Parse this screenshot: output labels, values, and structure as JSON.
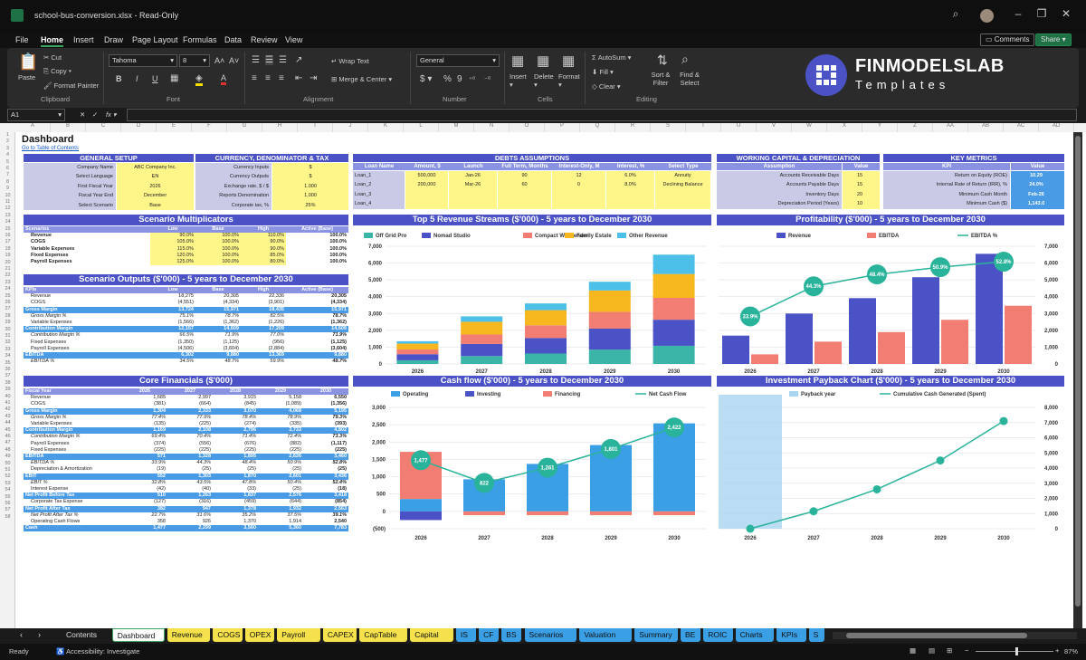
{
  "app": {
    "filename": "school-bus-conversion.xlsx",
    "mode": "Read-Only"
  },
  "menu": [
    "File",
    "Home",
    "Insert",
    "Draw",
    "Page Layout",
    "Formulas",
    "Data",
    "Review",
    "View"
  ],
  "top_buttons": {
    "comments": "Comments",
    "share": "Share"
  },
  "ribbon": {
    "paste": "Paste",
    "cut": "Cut",
    "copy": "Copy",
    "format_painter": "Format Painter",
    "clipboard": "Clipboard",
    "font_name": "Tahoma",
    "font_size": "8",
    "font": "Font",
    "wrap_text": "Wrap Text",
    "merge_center": "Merge & Center",
    "alignment": "Alignment",
    "number_format": "General",
    "number": "Number",
    "insert": "Insert",
    "delete": "Delete",
    "format": "Format",
    "cells": "Cells",
    "autosum": "AutoSum",
    "fill": "Fill",
    "clear": "Clear",
    "sort_filter": "Sort & Filter",
    "find_select": "Find & Select",
    "editing": "Editing",
    "bold": "B",
    "italic": "I",
    "underline": "U",
    "grow": "A",
    "fx": "fx"
  },
  "logo": {
    "line1": "FINMODELSLAB",
    "line2": "Templates"
  },
  "namebox": "A1",
  "columns": [
    "A",
    "B",
    "C",
    "D",
    "E",
    "F",
    "G",
    "H",
    "I",
    "J",
    "K",
    "L",
    "M",
    "N",
    "O",
    "P",
    "Q",
    "R",
    "S",
    "T",
    "U",
    "V",
    "W",
    "X",
    "Y",
    "Z",
    "AA",
    "AB",
    "AC",
    "AD"
  ],
  "sheet": {
    "title": "Dashboard",
    "toc_link": "Go to Table of Contents",
    "general_setup": {
      "title": "GENERAL SETUP",
      "rows": [
        [
          "Company Name",
          "ABC Company Inc."
        ],
        [
          "Select Language",
          "EN"
        ],
        [
          "First Fiscal Year",
          "2026"
        ],
        [
          "Fiscal Year End",
          "December"
        ],
        [
          "Select Scenario",
          "Base"
        ]
      ]
    },
    "currency": {
      "title": "CURRENCY, DENOMINATOR & TAX",
      "rows": [
        [
          "Currency Inputs",
          "$"
        ],
        [
          "Currency Outputs",
          "$"
        ],
        [
          "Exchange rate, $ / $",
          "1.000"
        ],
        [
          "Reports Denomination",
          "1,000"
        ],
        [
          "Corporate tax, %",
          "25%"
        ]
      ]
    },
    "debts": {
      "title": "DEBTS ASSUMPTIONS",
      "headers": [
        "Loan Name",
        "Amount, $",
        "Launch",
        "Full Term, Months",
        "Interest-Only, M",
        "Interest, %",
        "Select Type"
      ],
      "rows": [
        [
          "Loan_1",
          "500,000",
          "Jan-26",
          "90",
          "12",
          "6.0%",
          "Annuity"
        ],
        [
          "Loan_2",
          "200,000",
          "Mar-26",
          "60",
          "0",
          "8.0%",
          "Declining Balance"
        ],
        [
          "Loan_3",
          "",
          "",
          "",
          "",
          "",
          ""
        ],
        [
          "Loan_4",
          "",
          "",
          "",
          "",
          "",
          ""
        ]
      ]
    },
    "wc": {
      "title": "WORKING CAPITAL & DEPRECIATION",
      "headers": [
        "Assumption",
        "Value"
      ],
      "rows": [
        [
          "Accounts Receivable Days",
          "15"
        ],
        [
          "Accounts Payable Days",
          "15"
        ],
        [
          "Inventory Days",
          "20"
        ],
        [
          "Depreciation Period (Years)",
          "10"
        ]
      ]
    },
    "km": {
      "title": "KEY METRICS",
      "headers": [
        "KPI",
        "Value"
      ],
      "rows": [
        [
          "Return on Equity (ROE)",
          "10.29"
        ],
        [
          "Internal Rate of Return (IRR), %",
          "24.0%"
        ],
        [
          "Minimum Cash Month",
          "Feb-26"
        ],
        [
          "Minimum Cash ($)",
          "1,143.0"
        ]
      ]
    },
    "scen_mult": {
      "title": "Scenario Multiplicators",
      "headers": [
        "Scenarios",
        "Low",
        "Base",
        "High",
        "Active (Base)"
      ],
      "rows": [
        [
          "Revenue",
          "90.0%",
          "100.0%",
          "110.0%",
          "100.0%"
        ],
        [
          "COGS",
          "105.0%",
          "100.0%",
          "90.0%",
          "100.0%"
        ],
        [
          "Variable Expenses",
          "115.0%",
          "100.0%",
          "90.0%",
          "100.0%"
        ],
        [
          "Fixed Expenses",
          "120.0%",
          "100.0%",
          "85.0%",
          "100.0%"
        ],
        [
          "Payroll Expenses",
          "125.0%",
          "100.0%",
          "80.0%",
          "100.0%"
        ]
      ]
    },
    "scen_out": {
      "title": "Scenario Outputs ($'000) - 5 years to December 2030",
      "headers": [
        "KPIs",
        "Low",
        "Base",
        "High",
        "Active (Base)"
      ],
      "rows": [
        [
          "Revenue",
          "18,275",
          "20,305",
          "22,336",
          "20,305",
          ""
        ],
        [
          "COGS",
          "(4,551)",
          "(4,334)",
          "(3,901)",
          "(4,334)",
          ""
        ],
        [
          "Gross Margin",
          "13,724",
          "15,971",
          "18,435",
          "15,971",
          "hl"
        ],
        [
          "Gross Margin %",
          "75.1%",
          "78.7%",
          "82.5%",
          "78.7%",
          "it"
        ],
        [
          "Variable Expenses",
          "(1,566)",
          "(1,362)",
          "(1,226)",
          "(1,362)",
          ""
        ],
        [
          "Contribution Margin",
          "12,157",
          "14,609",
          "17,209",
          "14,609",
          "hl"
        ],
        [
          "Contribution Margin %",
          "66.5%",
          "71.9%",
          "77.0%",
          "71.9%",
          "it"
        ],
        [
          "Fixed Expenses",
          "(1,350)",
          "(1,125)",
          "(956)",
          "(1,125)",
          ""
        ],
        [
          "Payroll Expenses",
          "(4,506)",
          "(3,604)",
          "(2,884)",
          "(3,604)",
          ""
        ],
        [
          "EBITDA",
          "6,302",
          "9,880",
          "13,369",
          "9,880",
          "hl"
        ],
        [
          "EBITDA %",
          "34.5%",
          "48.7%",
          "59.9%",
          "48.7%",
          "it"
        ]
      ]
    },
    "core": {
      "title": "Core Financials ($'000)",
      "headers": [
        "Fiscal Year",
        "2026",
        "2027",
        "2028",
        "2029",
        "2030"
      ],
      "rows": [
        [
          "Revenue",
          "1,685",
          "2,997",
          "3,915",
          "5,158",
          "6,550",
          ""
        ],
        [
          "COGS",
          "(381)",
          "(664)",
          "(845)",
          "(1,089)",
          "(1,356)",
          ""
        ],
        [
          "Gross Margin",
          "1,304",
          "2,333",
          "3,070",
          "4,068",
          "5,195",
          "hl"
        ],
        [
          "Gross Margin %",
          "77.4%",
          "77.9%",
          "78.4%",
          "78.9%",
          "79.3%",
          "it"
        ],
        [
          "Variable Expenses",
          "(135)",
          "(225)",
          "(274)",
          "(335)",
          "(393)",
          ""
        ],
        [
          "Contribution Margin",
          "1,169",
          "2,108",
          "2,796",
          "3,733",
          "4,802",
          "hl"
        ],
        [
          "Contribution Margin %",
          "69.4%",
          "70.4%",
          "71.4%",
          "72.4%",
          "73.3%",
          "it"
        ],
        [
          "Payroll Expenses",
          "(374)",
          "(556)",
          "(676)",
          "(882)",
          "(1,117)",
          ""
        ],
        [
          "Fixed Expenses",
          "(225)",
          "(225)",
          "(225)",
          "(225)",
          "(225)",
          ""
        ],
        [
          "EBITDA",
          "571",
          "1,328",
          "1,895",
          "2,626",
          "3,460",
          "hl"
        ],
        [
          "EBITDA %",
          "33.9%",
          "44.3%",
          "48.4%",
          "50.9%",
          "52.8%",
          "it"
        ],
        [
          "Depreciation & Amortization",
          "(19)",
          "(25)",
          "(25)",
          "(25)",
          "(25)",
          ""
        ],
        [
          "EBIT",
          "552",
          "1,303",
          "1,870",
          "2,601",
          "3,436",
          "hl"
        ],
        [
          "EBIT %",
          "32.8%",
          "43.5%",
          "47.8%",
          "50.4%",
          "52.4%",
          "it"
        ],
        [
          "Interest Expense",
          "(42)",
          "(40)",
          "(33)",
          "(25)",
          "(18)",
          ""
        ],
        [
          "Net Profit Before Tax",
          "510",
          "1,263",
          "1,837",
          "2,576",
          "3,418",
          "hl"
        ],
        [
          "Corporate Tax Expense",
          "(127)",
          "(316)",
          "(459)",
          "(644)",
          "(854)",
          ""
        ],
        [
          "Net Profit After Tax",
          "382",
          "947",
          "1,378",
          "1,932",
          "2,563",
          "hl"
        ],
        [
          "Net Profit After Tax %",
          "22.7%",
          "31.6%",
          "35.2%",
          "37.5%",
          "39.1%",
          "it"
        ],
        [
          "Operating Cash Flows",
          "358",
          "926",
          "1,370",
          "1,914",
          "2,540",
          ""
        ],
        [
          "Cash",
          "1,477",
          "2,299",
          "3,560",
          "5,360",
          "7,783",
          "hl"
        ]
      ]
    }
  },
  "chart_data": [
    {
      "type": "bar",
      "title": "Top 5 Revenue Streams ($'000) - 5 years to December 2030",
      "stacked": true,
      "categories": [
        "2026",
        "2027",
        "2028",
        "2029",
        "2030"
      ],
      "series": [
        {
          "name": "Off Grid Pro",
          "values": [
            220,
            470,
            620,
            850,
            1080
          ]
        },
        {
          "name": "Nomad Studio",
          "values": [
            360,
            720,
            920,
            1250,
            1550
          ]
        },
        {
          "name": "Compact Weekender",
          "values": [
            280,
            560,
            760,
            1000,
            1300
          ]
        },
        {
          "name": "Family Estate",
          "values": [
            350,
            760,
            900,
            1270,
            1420
          ]
        },
        {
          "name": "Other Revenue",
          "values": [
            140,
            320,
            400,
            520,
            1150
          ]
        }
      ],
      "ylim": [
        0,
        7000
      ],
      "yticks": [
        "0",
        "1,000",
        "2,000",
        "3,000",
        "4,000",
        "5,000",
        "6,000",
        "7,000"
      ],
      "legend": "top",
      "colors": [
        "#3ab5a8",
        "#4a52c6",
        "#f27d72",
        "#f6b81e",
        "#4cc0e8"
      ]
    },
    {
      "type": "bar+line",
      "title": "Profitability ($'000) - 5 years to December 2030",
      "categories": [
        "2026",
        "2027",
        "2028",
        "2029",
        "2030"
      ],
      "series": [
        {
          "name": "Revenue",
          "values": [
            1685,
            2997,
            3915,
            5158,
            6550
          ]
        },
        {
          "name": "EBITDA",
          "values": [
            571,
            1328,
            1895,
            2626,
            3460
          ]
        },
        {
          "name": "EBITDA %",
          "values": [
            33.9,
            44.3,
            48.4,
            50.9,
            52.8
          ],
          "labels": [
            "33.9%",
            "44.3%",
            "48.4%",
            "50.9%",
            "52.8%"
          ]
        }
      ],
      "ylim": [
        0,
        7000
      ],
      "yticks": [
        "0",
        "1,000",
        "2,000",
        "3,000",
        "4,000",
        "5,000",
        "6,000",
        "7,000"
      ],
      "legend": "top",
      "colors": [
        "#4a52c6",
        "#f27d72",
        "#2ab39b"
      ]
    },
    {
      "type": "bar+line",
      "title": "Cash flow ($'000) - 5 years to December 2030",
      "categories": [
        "2026",
        "2027",
        "2028",
        "2029",
        "2030"
      ],
      "series": [
        {
          "name": "Operating",
          "values": [
            358,
            926,
            1370,
            1914,
            2540
          ]
        },
        {
          "name": "Investing",
          "values": [
            -250,
            0,
            0,
            0,
            0
          ]
        },
        {
          "name": "Financing",
          "values": [
            1360,
            -110,
            -110,
            -110,
            -110
          ]
        },
        {
          "name": "Net Cash Flow",
          "values": [
            1477,
            822,
            1261,
            1801,
            2422
          ],
          "labels": [
            "1,477",
            "822",
            "1,261",
            "1,801",
            "2,422"
          ]
        }
      ],
      "ylim": [
        -500,
        3000
      ],
      "yticks": [
        "(500)",
        "0",
        "500",
        "1,000",
        "1,500",
        "2,000",
        "2,500",
        "3,000"
      ],
      "legend": "top",
      "colors": [
        "#3a9fe5",
        "#4a52c6",
        "#f27d72",
        "#2ab39b"
      ]
    },
    {
      "type": "line",
      "title": "Investment Payback Chart ($'000) - 5 years to December 2030",
      "categories": [
        "2026",
        "2027",
        "2028",
        "2029",
        "2030"
      ],
      "series": [
        {
          "name": "Payback year",
          "values": [
            1,
            0,
            0,
            0,
            0
          ]
        },
        {
          "name": "Cumulative Cash Generated (Spent)",
          "values": [
            0,
            1150,
            2600,
            4500,
            7100
          ]
        }
      ],
      "ylim": [
        0,
        8000
      ],
      "yticks": [
        "0",
        "1,000",
        "2,000",
        "3,000",
        "4,000",
        "5,000",
        "6,000",
        "7,000",
        "8,000"
      ],
      "legend": "top",
      "colors": [
        "#a9d4f0",
        "#2ab39b"
      ]
    }
  ],
  "tabs": [
    {
      "label": "Contents",
      "c": "tc"
    },
    {
      "label": "Dashboard",
      "c": "tw"
    },
    {
      "label": "Revenue",
      "c": "ty"
    },
    {
      "label": "COGS",
      "c": "ty"
    },
    {
      "label": "OPEX",
      "c": "ty"
    },
    {
      "label": "Payroll",
      "c": "ty"
    },
    {
      "label": "CAPEX",
      "c": "ty"
    },
    {
      "label": "CapTable",
      "c": "ty"
    },
    {
      "label": "Capital",
      "c": "ty"
    },
    {
      "label": "IS",
      "c": "tb"
    },
    {
      "label": "CF",
      "c": "tb"
    },
    {
      "label": "BS",
      "c": "tb"
    },
    {
      "label": "Scenarios",
      "c": "tb"
    },
    {
      "label": "Valuation",
      "c": "tb"
    },
    {
      "label": "Summary",
      "c": "tb"
    },
    {
      "label": "BE",
      "c": "tb"
    },
    {
      "label": "ROIC",
      "c": "tb"
    },
    {
      "label": "Charts",
      "c": "tb"
    },
    {
      "label": "KPIs",
      "c": "tb"
    },
    {
      "label": "S",
      "c": "tb"
    }
  ],
  "status": {
    "ready": "Ready",
    "accessibility": "Accessibility: Investigate",
    "zoom": "87%"
  }
}
